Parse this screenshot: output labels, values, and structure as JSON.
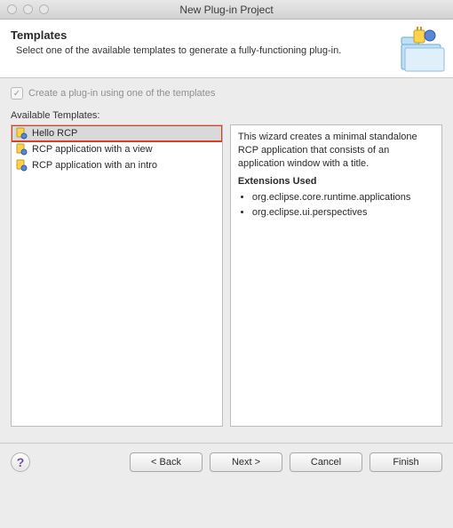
{
  "window": {
    "title": "New Plug-in Project"
  },
  "banner": {
    "heading": "Templates",
    "subtext": "Select one of the available templates to generate a fully-functioning plug-in."
  },
  "checkbox": {
    "label": "Create a plug-in using one of the templates",
    "checked_glyph": "✓"
  },
  "available_label": "Available Templates:",
  "templates": [
    {
      "label": "Hello RCP"
    },
    {
      "label": "RCP application with a view"
    },
    {
      "label": "RCP application with an intro"
    }
  ],
  "description": {
    "text": "This wizard creates a minimal standalone RCP application that consists of an application window with a title.",
    "ext_heading": "Extensions Used",
    "extensions": [
      "org.eclipse.core.runtime.applications",
      "org.eclipse.ui.perspectives"
    ]
  },
  "buttons": {
    "help": "?",
    "back": "< Back",
    "next": "Next >",
    "cancel": "Cancel",
    "finish": "Finish"
  }
}
